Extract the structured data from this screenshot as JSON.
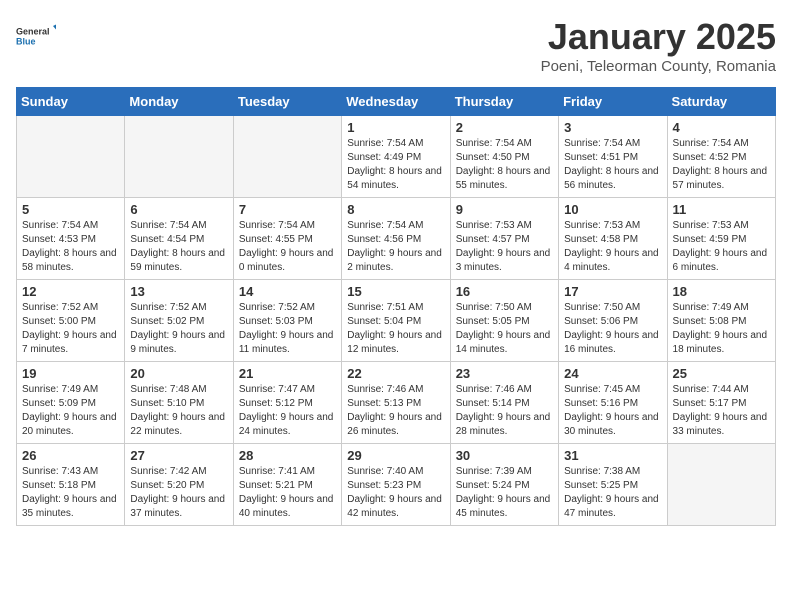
{
  "header": {
    "logo_general": "General",
    "logo_blue": "Blue",
    "title": "January 2025",
    "subtitle": "Poeni, Teleorman County, Romania"
  },
  "weekdays": [
    "Sunday",
    "Monday",
    "Tuesday",
    "Wednesday",
    "Thursday",
    "Friday",
    "Saturday"
  ],
  "weeks": [
    [
      {
        "day": "",
        "empty": true
      },
      {
        "day": "",
        "empty": true
      },
      {
        "day": "",
        "empty": true
      },
      {
        "day": "1",
        "sunrise": "7:54 AM",
        "sunset": "4:49 PM",
        "daylight": "8 hours and 54 minutes."
      },
      {
        "day": "2",
        "sunrise": "7:54 AM",
        "sunset": "4:50 PM",
        "daylight": "8 hours and 55 minutes."
      },
      {
        "day": "3",
        "sunrise": "7:54 AM",
        "sunset": "4:51 PM",
        "daylight": "8 hours and 56 minutes."
      },
      {
        "day": "4",
        "sunrise": "7:54 AM",
        "sunset": "4:52 PM",
        "daylight": "8 hours and 57 minutes."
      }
    ],
    [
      {
        "day": "5",
        "sunrise": "7:54 AM",
        "sunset": "4:53 PM",
        "daylight": "8 hours and 58 minutes."
      },
      {
        "day": "6",
        "sunrise": "7:54 AM",
        "sunset": "4:54 PM",
        "daylight": "8 hours and 59 minutes."
      },
      {
        "day": "7",
        "sunrise": "7:54 AM",
        "sunset": "4:55 PM",
        "daylight": "9 hours and 0 minutes."
      },
      {
        "day": "8",
        "sunrise": "7:54 AM",
        "sunset": "4:56 PM",
        "daylight": "9 hours and 2 minutes."
      },
      {
        "day": "9",
        "sunrise": "7:53 AM",
        "sunset": "4:57 PM",
        "daylight": "9 hours and 3 minutes."
      },
      {
        "day": "10",
        "sunrise": "7:53 AM",
        "sunset": "4:58 PM",
        "daylight": "9 hours and 4 minutes."
      },
      {
        "day": "11",
        "sunrise": "7:53 AM",
        "sunset": "4:59 PM",
        "daylight": "9 hours and 6 minutes."
      }
    ],
    [
      {
        "day": "12",
        "sunrise": "7:52 AM",
        "sunset": "5:00 PM",
        "daylight": "9 hours and 7 minutes."
      },
      {
        "day": "13",
        "sunrise": "7:52 AM",
        "sunset": "5:02 PM",
        "daylight": "9 hours and 9 minutes."
      },
      {
        "day": "14",
        "sunrise": "7:52 AM",
        "sunset": "5:03 PM",
        "daylight": "9 hours and 11 minutes."
      },
      {
        "day": "15",
        "sunrise": "7:51 AM",
        "sunset": "5:04 PM",
        "daylight": "9 hours and 12 minutes."
      },
      {
        "day": "16",
        "sunrise": "7:50 AM",
        "sunset": "5:05 PM",
        "daylight": "9 hours and 14 minutes."
      },
      {
        "day": "17",
        "sunrise": "7:50 AM",
        "sunset": "5:06 PM",
        "daylight": "9 hours and 16 minutes."
      },
      {
        "day": "18",
        "sunrise": "7:49 AM",
        "sunset": "5:08 PM",
        "daylight": "9 hours and 18 minutes."
      }
    ],
    [
      {
        "day": "19",
        "sunrise": "7:49 AM",
        "sunset": "5:09 PM",
        "daylight": "9 hours and 20 minutes."
      },
      {
        "day": "20",
        "sunrise": "7:48 AM",
        "sunset": "5:10 PM",
        "daylight": "9 hours and 22 minutes."
      },
      {
        "day": "21",
        "sunrise": "7:47 AM",
        "sunset": "5:12 PM",
        "daylight": "9 hours and 24 minutes."
      },
      {
        "day": "22",
        "sunrise": "7:46 AM",
        "sunset": "5:13 PM",
        "daylight": "9 hours and 26 minutes."
      },
      {
        "day": "23",
        "sunrise": "7:46 AM",
        "sunset": "5:14 PM",
        "daylight": "9 hours and 28 minutes."
      },
      {
        "day": "24",
        "sunrise": "7:45 AM",
        "sunset": "5:16 PM",
        "daylight": "9 hours and 30 minutes."
      },
      {
        "day": "25",
        "sunrise": "7:44 AM",
        "sunset": "5:17 PM",
        "daylight": "9 hours and 33 minutes."
      }
    ],
    [
      {
        "day": "26",
        "sunrise": "7:43 AM",
        "sunset": "5:18 PM",
        "daylight": "9 hours and 35 minutes."
      },
      {
        "day": "27",
        "sunrise": "7:42 AM",
        "sunset": "5:20 PM",
        "daylight": "9 hours and 37 minutes."
      },
      {
        "day": "28",
        "sunrise": "7:41 AM",
        "sunset": "5:21 PM",
        "daylight": "9 hours and 40 minutes."
      },
      {
        "day": "29",
        "sunrise": "7:40 AM",
        "sunset": "5:23 PM",
        "daylight": "9 hours and 42 minutes."
      },
      {
        "day": "30",
        "sunrise": "7:39 AM",
        "sunset": "5:24 PM",
        "daylight": "9 hours and 45 minutes."
      },
      {
        "day": "31",
        "sunrise": "7:38 AM",
        "sunset": "5:25 PM",
        "daylight": "9 hours and 47 minutes."
      },
      {
        "day": "",
        "empty": true
      }
    ]
  ]
}
